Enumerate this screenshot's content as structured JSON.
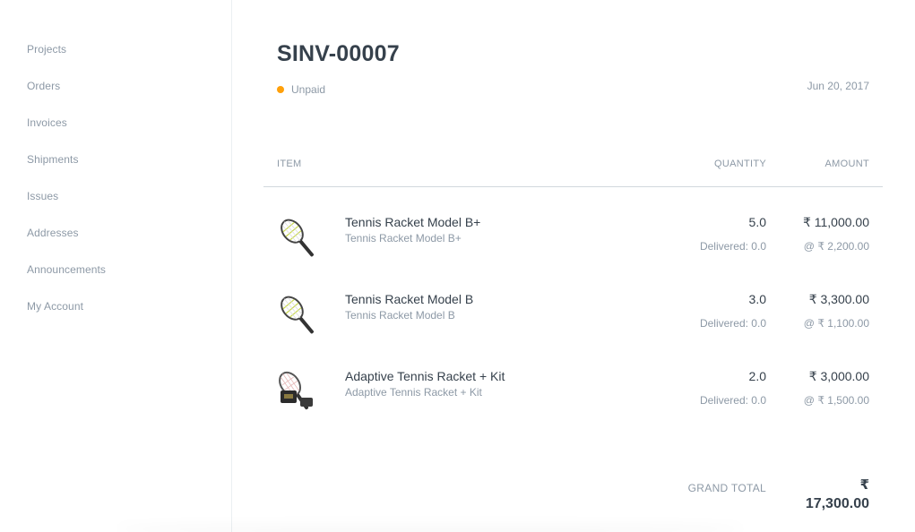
{
  "sidebar": {
    "items": [
      {
        "label": "Projects"
      },
      {
        "label": "Orders"
      },
      {
        "label": "Invoices"
      },
      {
        "label": "Shipments"
      },
      {
        "label": "Issues"
      },
      {
        "label": "Addresses"
      },
      {
        "label": "Announcements"
      },
      {
        "label": "My Account"
      }
    ]
  },
  "doc": {
    "title": "SINV-00007",
    "status": "Unpaid",
    "status_color": "#ffa00a",
    "date": "Jun 20, 2017"
  },
  "table": {
    "headers": {
      "item": "ITEM",
      "quantity": "QUANTITY",
      "amount": "AMOUNT"
    },
    "rows": [
      {
        "name": "Tennis Racket Model B+",
        "description": "Tennis Racket Model B+",
        "qty": "5.0",
        "delivered": "Delivered: 0.0",
        "amount": "₹ 11,000.00",
        "rate": "@ ₹ 2,200.00",
        "image": "tennis-racket-yellow"
      },
      {
        "name": "Tennis Racket Model B",
        "description": "Tennis Racket Model B",
        "qty": "3.0",
        "delivered": "Delivered: 0.0",
        "amount": "₹ 3,300.00",
        "rate": "@ ₹ 1,100.00",
        "image": "tennis-racket-yellow"
      },
      {
        "name": "Adaptive Tennis Racket + Kit",
        "description": "Adaptive Tennis Racket + Kit",
        "qty": "2.0",
        "delivered": "Delivered: 0.0",
        "amount": "₹ 3,000.00",
        "rate": "@ ₹ 1,500.00",
        "image": "tennis-racket-kit"
      }
    ]
  },
  "totals": {
    "label": "GRAND TOTAL",
    "currency": "₹",
    "value": "17,300.00"
  }
}
